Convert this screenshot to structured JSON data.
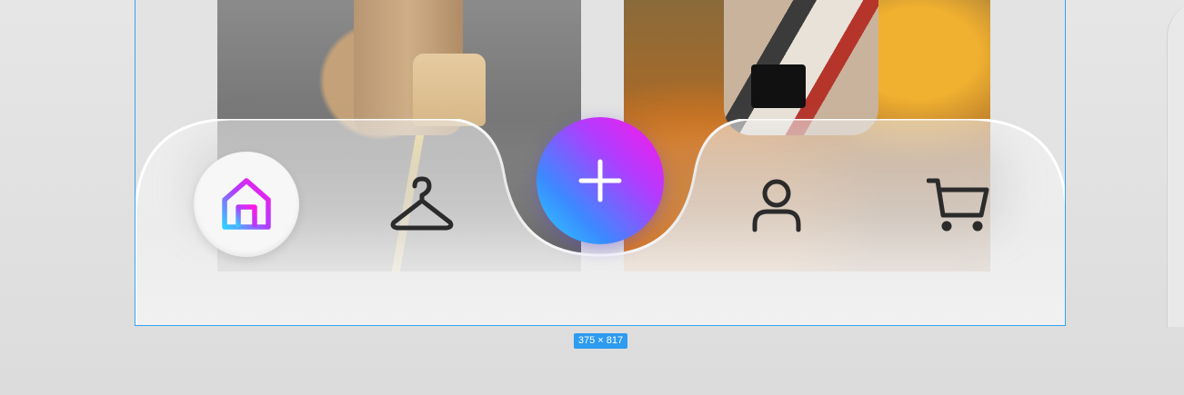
{
  "canvas": {
    "frame_size_label": "375 × 817"
  },
  "tab_bar": {
    "tabs": [
      {
        "id": "home",
        "icon": "home-icon",
        "selected": true
      },
      {
        "id": "wardrobe",
        "icon": "hanger-icon",
        "selected": false
      },
      {
        "id": "profile",
        "icon": "user-icon",
        "selected": false
      },
      {
        "id": "cart",
        "icon": "cart-icon",
        "selected": false
      }
    ],
    "center_action": {
      "icon": "plus-icon"
    }
  },
  "colors": {
    "frame_selection": "#31a6f2",
    "size_badge": "#2d9bf0",
    "gradient_start": "#ff17e4",
    "gradient_mid": "#b13cff",
    "gradient_end": "#2fd0ff",
    "icon_inactive": "#2b2b2b"
  }
}
